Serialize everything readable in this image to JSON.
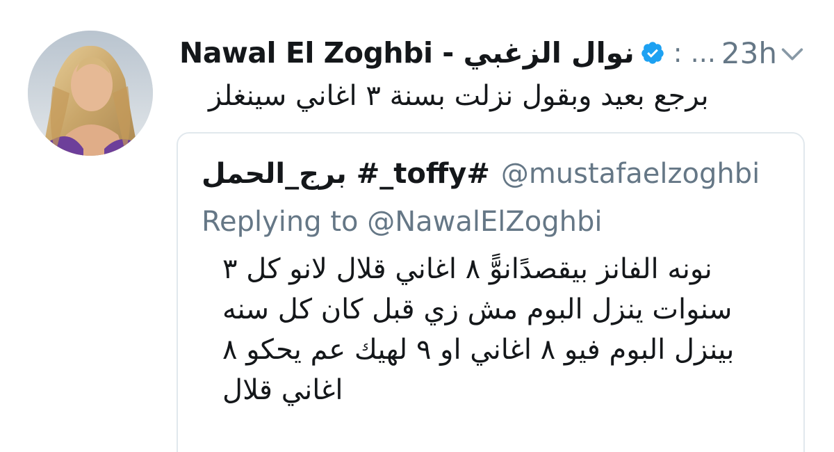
{
  "tweet": {
    "display_name": "Nawal El Zoghbi - نوال الزغبي",
    "separator": ": ...",
    "time": "23h",
    "text": "برجع بعيد وبقول نزلت بسنة ٣ اغاني سينغلز",
    "verified": true
  },
  "quoted_tweet": {
    "display_name": "#toffy_# برج_الحمل",
    "handle": "@mustafaelzoghbi",
    "replying_to": "Replying to @NawalElZoghbi",
    "text": "نونه الفانز بيقصدًانوًّ ٨ اغاني قلال لانو كل ٣ سنوات ينزل البوم مش زي قبل كان كل سنه بينزل البوم فيو ٨ اغاني او ٩ لهيك عم يحكو ٨ اغاني قلال"
  },
  "colors": {
    "text_primary": "#14171a",
    "text_secondary": "#657786",
    "verified_badge": "#1da1f2",
    "border": "#e1e8ed"
  },
  "icons": {
    "verified": "verified-badge-icon",
    "caret": "chevron-down-icon"
  }
}
